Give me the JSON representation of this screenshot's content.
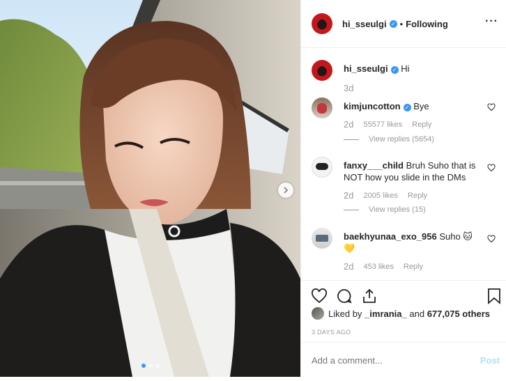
{
  "post": {
    "username": "hi_sseulgi",
    "follow_status": "Following",
    "bullet": "•",
    "carousel_slides": 3,
    "active_slide": 1
  },
  "caption": {
    "username": "hi_sseulgi",
    "text": "Hi",
    "time": "3d"
  },
  "comments": [
    {
      "username": "kimjuncotton",
      "verified": true,
      "text": "Bye",
      "time": "2d",
      "likes": "55577 likes",
      "reply_label": "Reply",
      "view_replies": "View replies (5654)"
    },
    {
      "username": "fanxy___child",
      "verified": false,
      "text": "Bruh Suho that is NOT how you slide in the DMs",
      "time": "2d",
      "likes": "2005 likes",
      "reply_label": "Reply",
      "view_replies": "View replies (15)"
    },
    {
      "username": "baekhyunaa_exo_956",
      "verified": false,
      "text": "Suho 🐱 💛",
      "time": "2d",
      "likes": "453 likes",
      "reply_label": "Reply"
    }
  ],
  "likes": {
    "prefix": "Liked by",
    "user": "_imrania_",
    "middle": "and",
    "count": "677,075 others"
  },
  "timestamp": "3 DAYS AGO",
  "add_comment": {
    "placeholder": "Add a comment...",
    "post_label": "Post"
  },
  "colors": {
    "verified": "#3897f0",
    "muted": "#999999",
    "post_disabled": "#b2dffc"
  }
}
